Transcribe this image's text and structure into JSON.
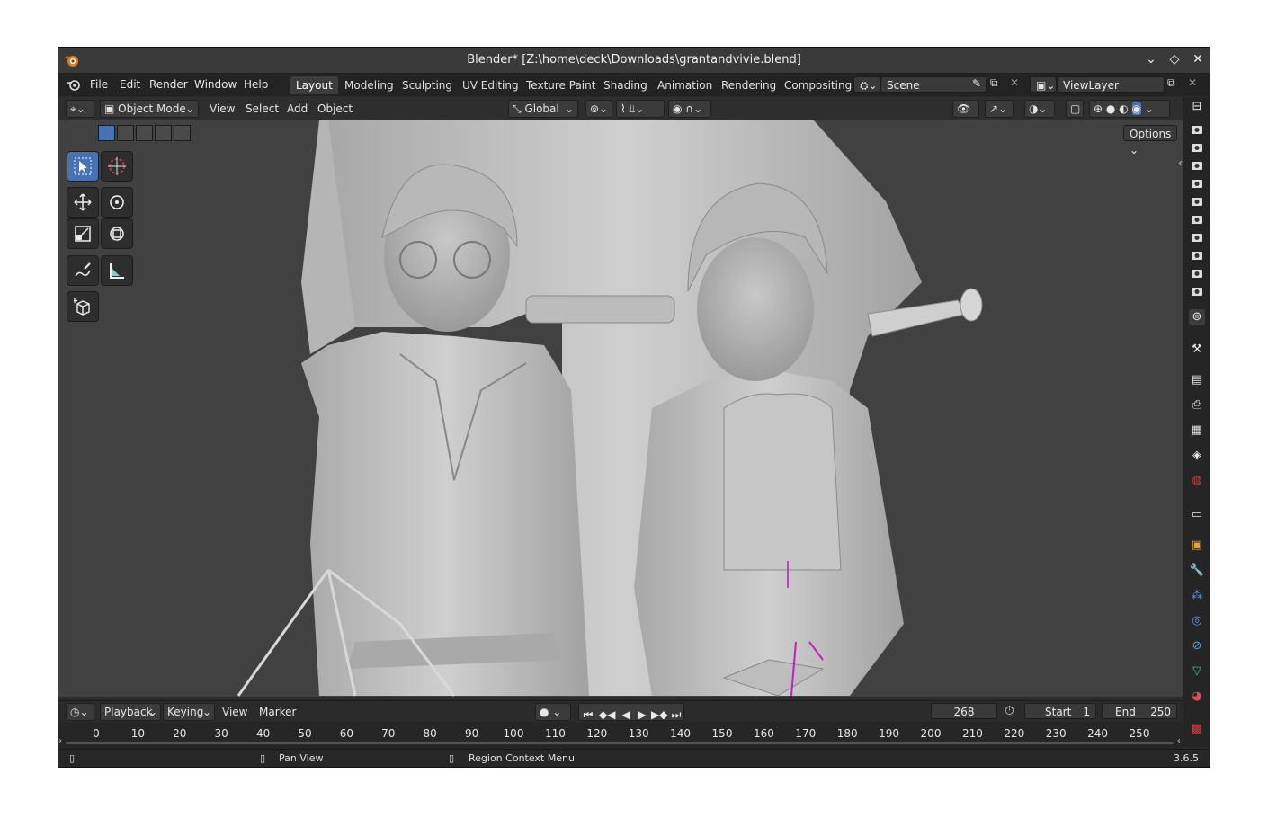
{
  "window": {
    "title": "Blender* [Z:\\home\\deck\\Downloads\\grantandvivie.blend]"
  },
  "menu": {
    "items": [
      "File",
      "Edit",
      "Render",
      "Window",
      "Help"
    ]
  },
  "workspaces": [
    "Layout",
    "Modeling",
    "Sculpting",
    "UV Editing",
    "Texture Paint",
    "Shading",
    "Animation",
    "Rendering",
    "Compositing"
  ],
  "scene": {
    "name": "Scene"
  },
  "view_layer": {
    "name": "ViewLayer"
  },
  "viewport_header": {
    "mode": "Object Mode",
    "menus": [
      "View",
      "Select",
      "Add",
      "Object"
    ],
    "orientation": "Global",
    "options_label": "Options"
  },
  "timeline": {
    "menus": [
      "Playback",
      "Keying",
      "View",
      "Marker"
    ],
    "current_frame": "268",
    "start_label": "Start",
    "start_value": "1",
    "end_label": "End",
    "end_value": "250",
    "ruler": [
      "0",
      "10",
      "20",
      "30",
      "40",
      "50",
      "60",
      "70",
      "80",
      "90",
      "100",
      "110",
      "120",
      "130",
      "140",
      "150",
      "160",
      "170",
      "180",
      "190",
      "200",
      "210",
      "220",
      "230",
      "240",
      "250"
    ]
  },
  "status": {
    "pan": "Pan View",
    "context": "Region Context Menu",
    "version": "3.6.5"
  },
  "icons": {
    "accent": "#4772b3",
    "outliner": "outliner-icon",
    "camera": "camera-icon"
  }
}
